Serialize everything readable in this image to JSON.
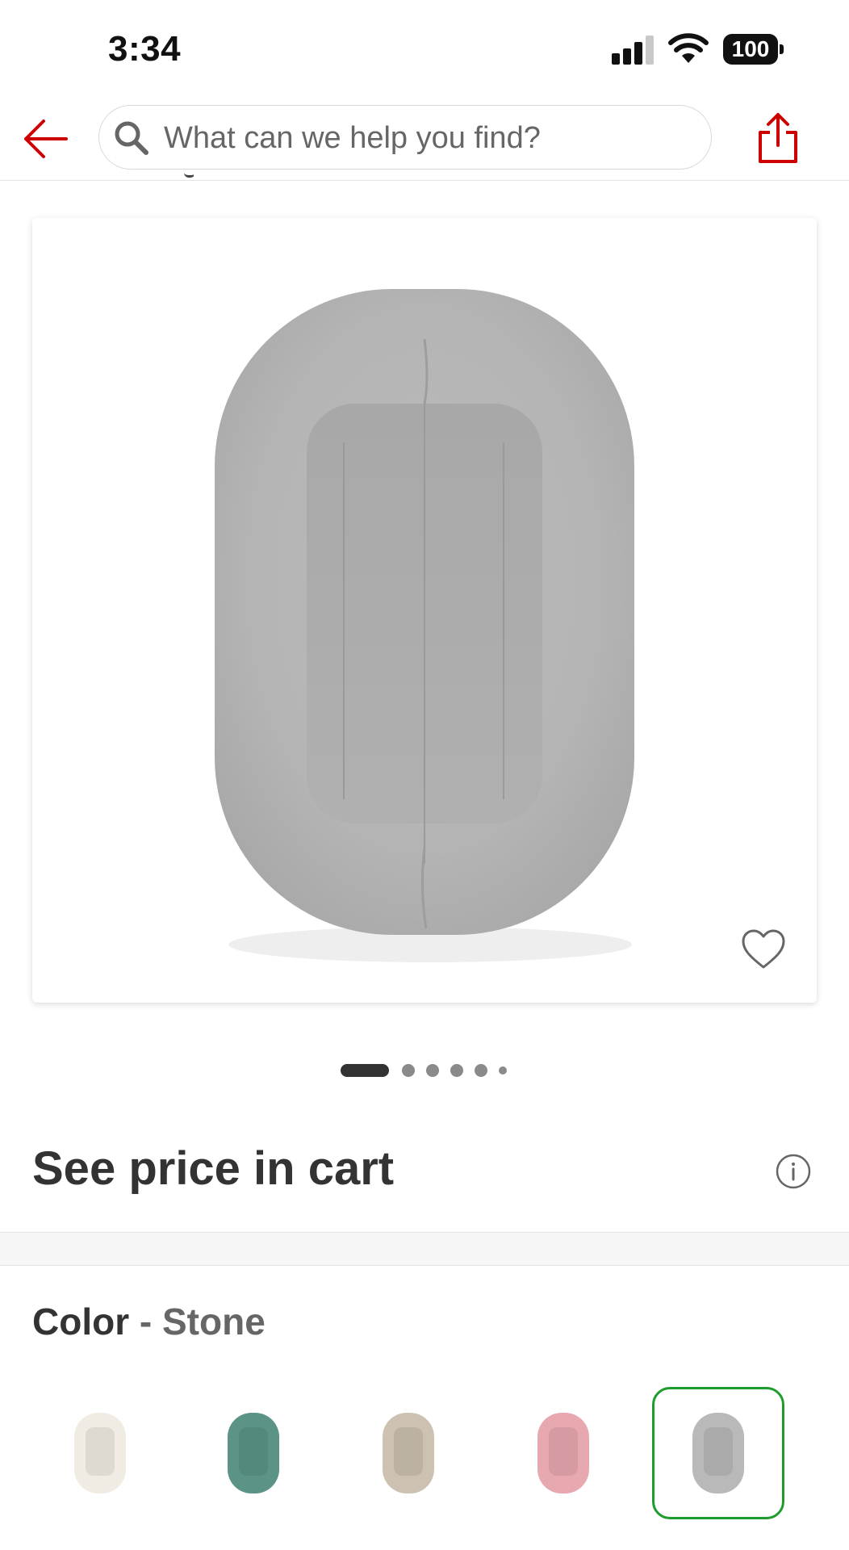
{
  "status_bar": {
    "time": "3:34",
    "battery": "100"
  },
  "header": {
    "back_icon": "arrow-left-icon",
    "search": {
      "placeholder": "What can we help you find?"
    },
    "share_icon": "share-icon",
    "accent_color": "#cc0000"
  },
  "product": {
    "image_alt": "Gray baby lounger pillow",
    "favorite_icon": "heart-icon",
    "carousel": {
      "total": 6,
      "active": 1
    },
    "price_text": "See price in cart",
    "info_icon": "info-icon"
  },
  "color": {
    "label": "Color",
    "separator": "-",
    "selected": "Stone",
    "options": [
      {
        "name": "cream",
        "color": "#f1ece3"
      },
      {
        "name": "teal",
        "color": "#5b9487"
      },
      {
        "name": "taupe",
        "color": "#cdc2b1"
      },
      {
        "name": "pink",
        "color": "#e8a8b0"
      },
      {
        "name": "stone",
        "color": "#b9b9b9",
        "selected": true
      }
    ],
    "selected_border_color": "#1e9c2e"
  }
}
